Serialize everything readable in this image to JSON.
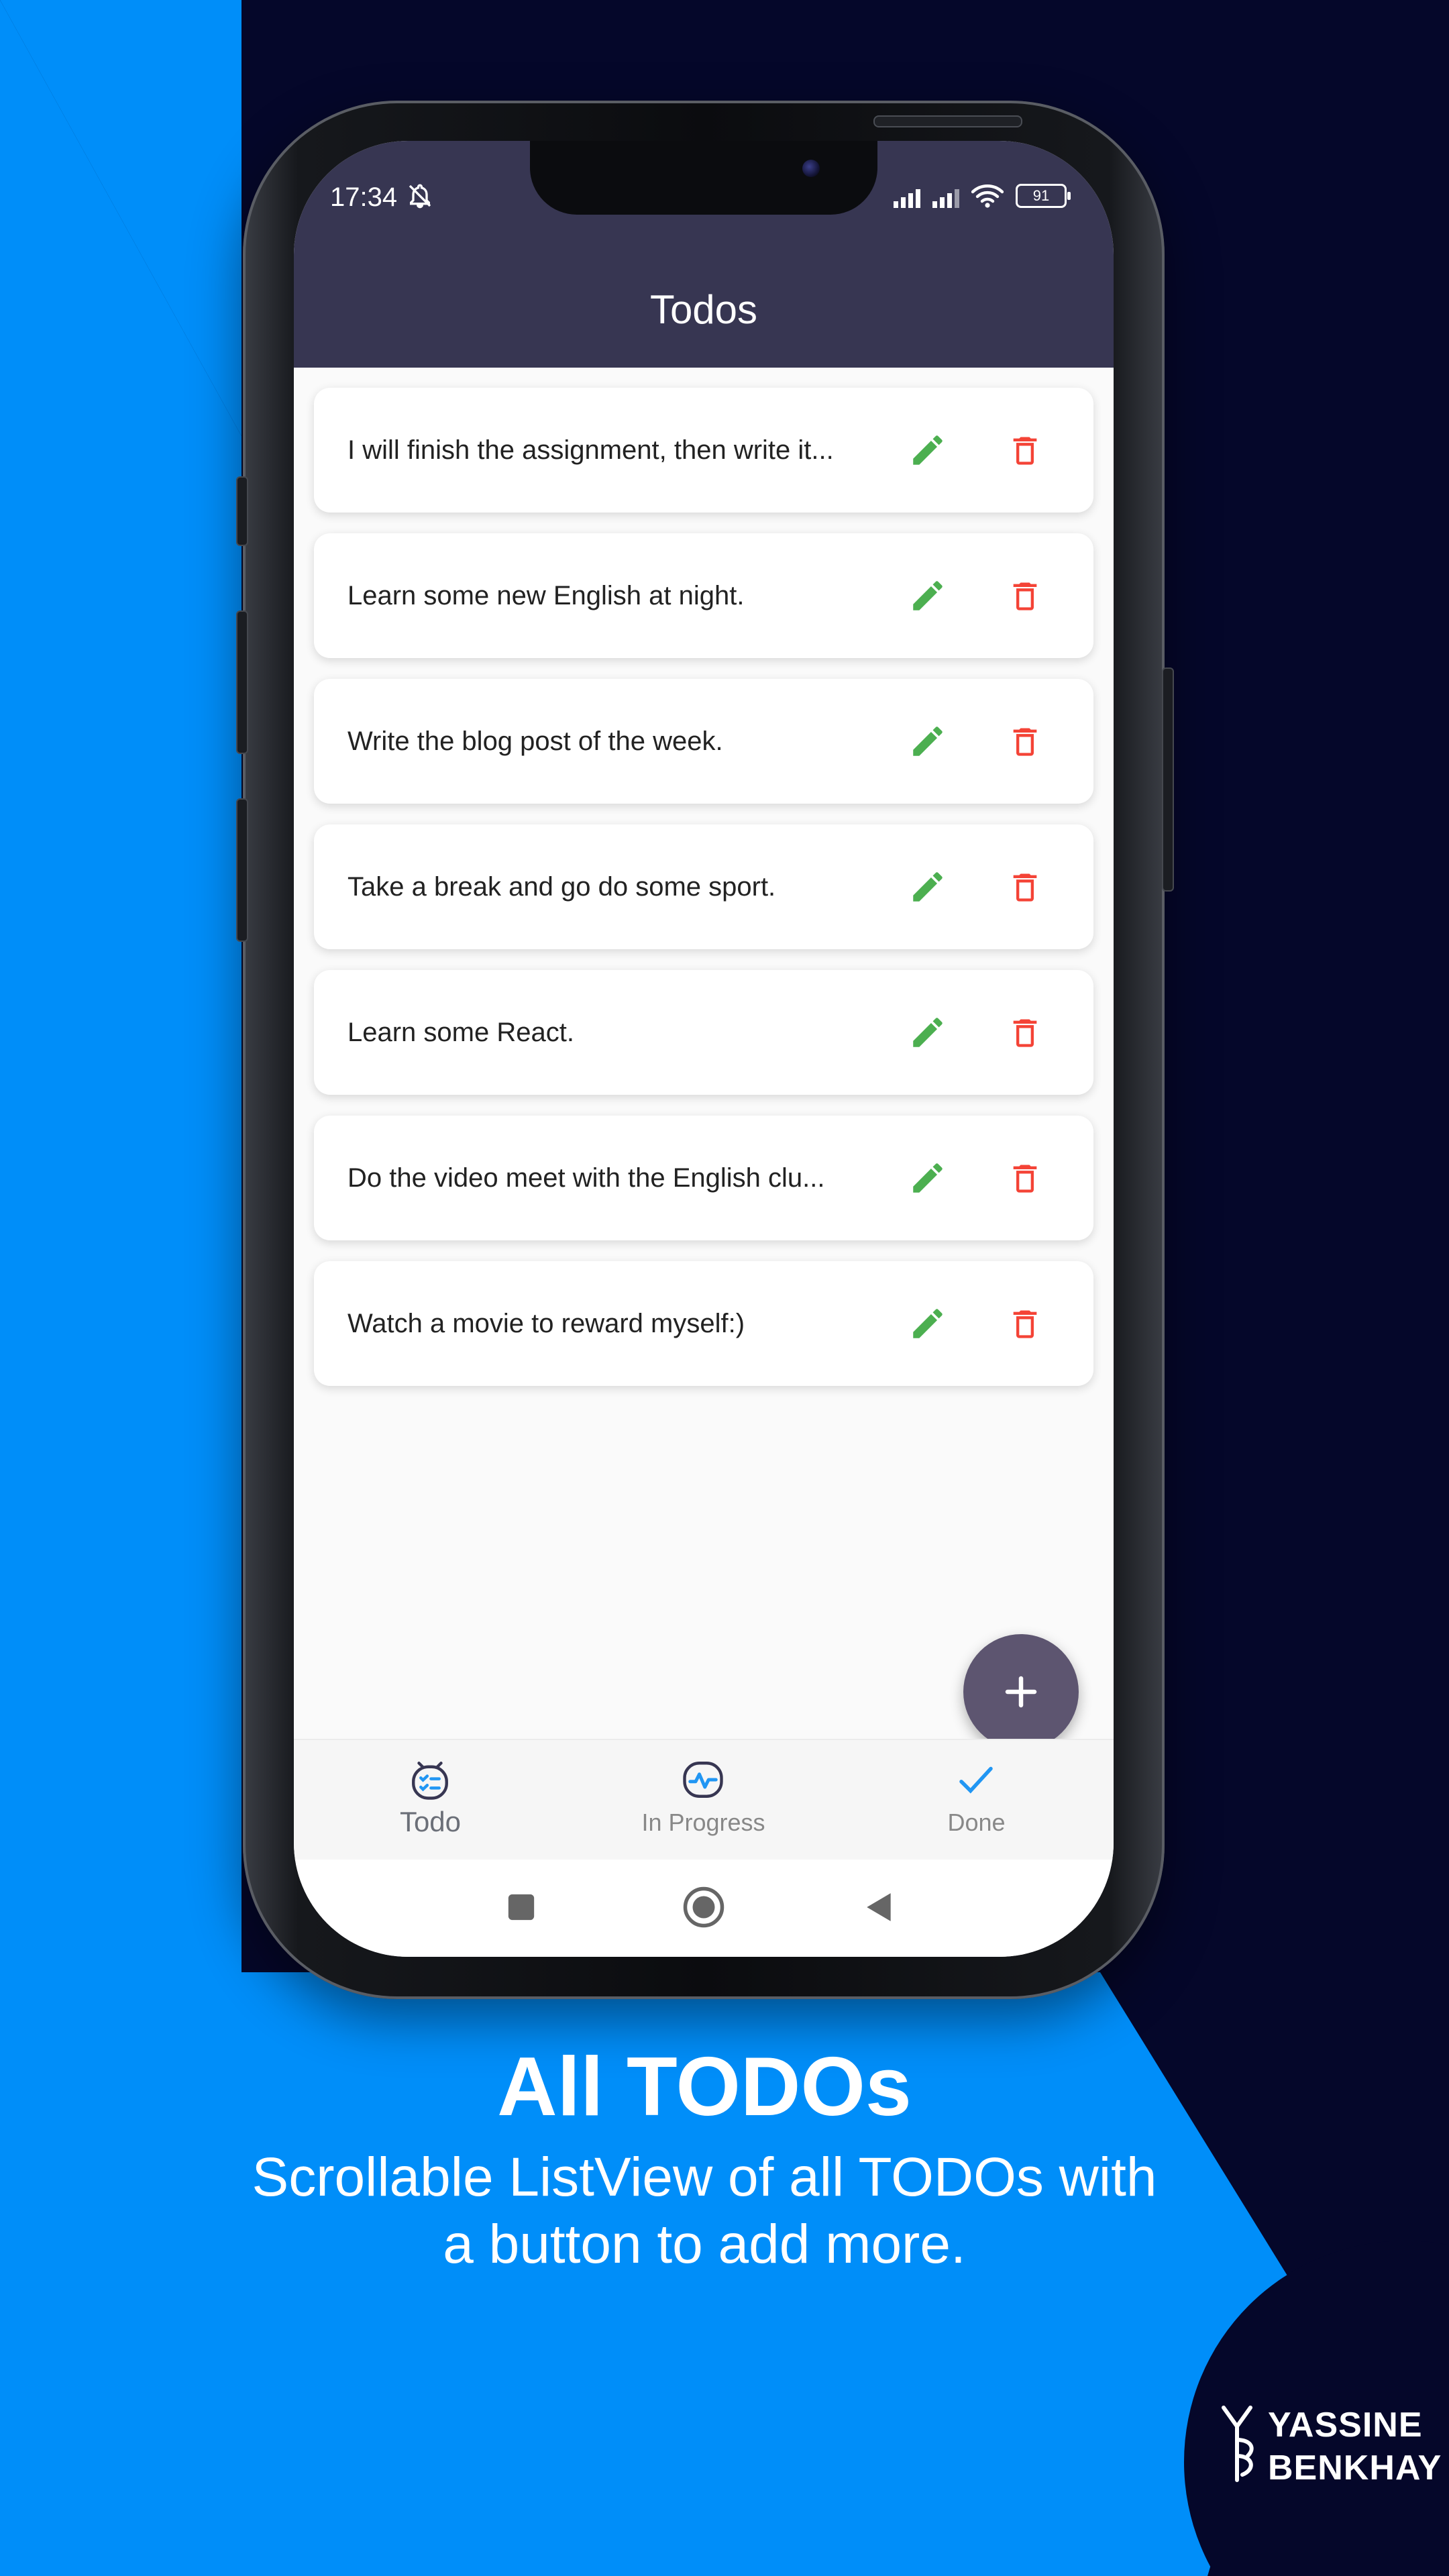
{
  "status_bar": {
    "time": "17:34",
    "battery": "91"
  },
  "app_bar": {
    "title": "Todos"
  },
  "todos": [
    {
      "text": "I will finish the assignment, then write it..."
    },
    {
      "text": "Learn some new English at night."
    },
    {
      "text": "Write the blog post of the week."
    },
    {
      "text": "Take a break and go do some sport."
    },
    {
      "text": "Learn some React."
    },
    {
      "text": "Do the video meet with the English clu..."
    },
    {
      "text": "Watch a movie to reward myself:)"
    }
  ],
  "icons": {
    "edit": "pencil-icon",
    "delete": "trash-icon",
    "fab": "plus-icon"
  },
  "bottom_nav": {
    "items": [
      {
        "label": "Todo",
        "icon": "checklist-icon",
        "active": true
      },
      {
        "label": "In Progress",
        "icon": "activity-icon",
        "active": false
      },
      {
        "label": "Done",
        "icon": "check-icon",
        "active": false
      }
    ]
  },
  "caption": {
    "title": "All TODOs",
    "subtitle_line1": "Scrollable ListView of all TODOs with",
    "subtitle_line2": "a button to add more."
  },
  "brand": {
    "line1": "YASSINE",
    "line2": "BENKHAY"
  },
  "colors": {
    "background_dark": "#05072a",
    "background_blue": "#008ef9",
    "app_bar": "#373652",
    "edit_green": "#4caf50",
    "delete_red": "#f44336",
    "fab": "#5d5570",
    "nav_active_icon": "#2196f3"
  }
}
